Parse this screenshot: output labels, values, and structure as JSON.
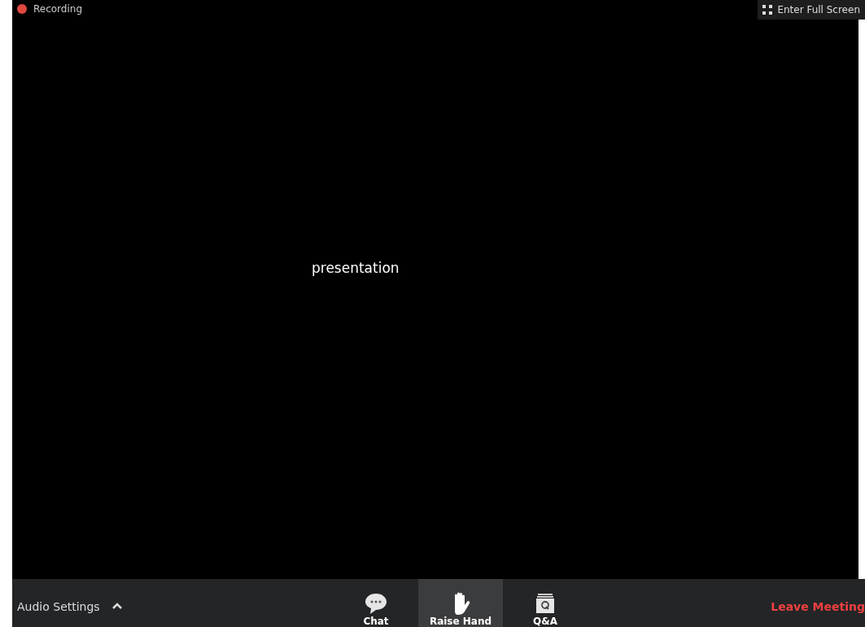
{
  "recording": {
    "label": "Recording"
  },
  "fullscreen_button": {
    "label": "Enter Full Screen"
  },
  "content": {
    "text": "presentation"
  },
  "toolbar": {
    "audio_settings": "Audio Settings",
    "items": [
      {
        "kind": "chat",
        "label": "Chat",
        "selected": false
      },
      {
        "kind": "hand",
        "label": "Raise Hand",
        "selected": true
      },
      {
        "kind": "qa",
        "label": "Q&A",
        "selected": false
      }
    ],
    "leave": "Leave Meeting"
  }
}
